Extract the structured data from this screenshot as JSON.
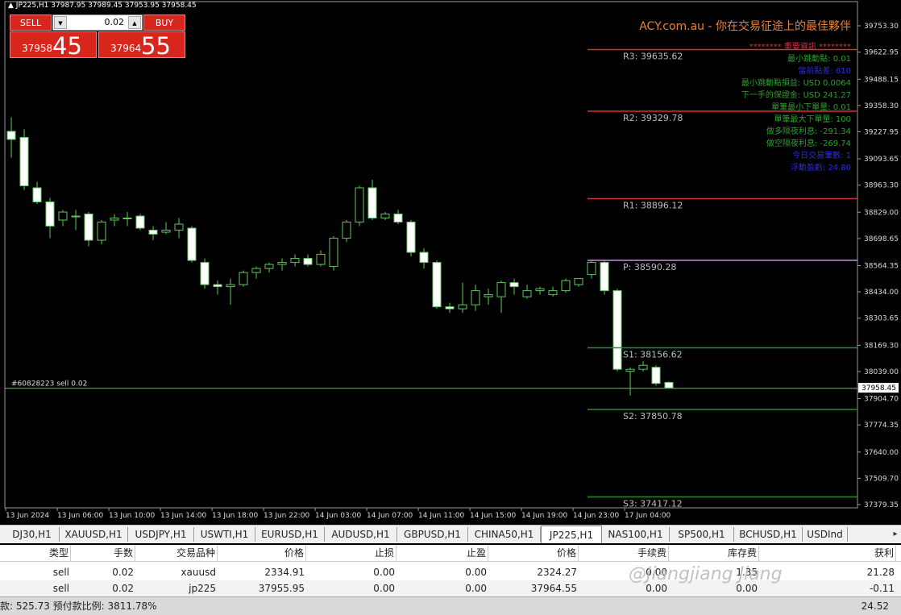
{
  "chart_header": {
    "symbol_line": "JP225,H1  37987.95 37989.45 37953.95 37958.45"
  },
  "trade_panel": {
    "sell_label": "SELL",
    "buy_label": "BUY",
    "lot": "0.02",
    "sell_price_small": "37958",
    "sell_price_big": "45",
    "buy_price_small": "37964",
    "buy_price_big": "55"
  },
  "brand_text": "ACY.com.au - 你在交易征途上的最佳夥伴",
  "info_panel": {
    "header": "******** 重要資訊 ********",
    "rows": [
      {
        "text": "最小跳動點: 0.01",
        "color": "#2e9e2e"
      },
      {
        "text": "當前點差: 610",
        "color": "#2a2ae0"
      },
      {
        "text": "最小跳動點損益: USD 0.0064",
        "color": "#2e9e2e"
      },
      {
        "text": "下一手的保證金: USD 241.27",
        "color": "#2e9e2e"
      },
      {
        "text": "單筆最小下單量: 0.01",
        "color": "#2e9e2e"
      },
      {
        "text": "單筆最大下單量: 100",
        "color": "#2e9e2e"
      },
      {
        "text": "做多隔夜利息: -291.34",
        "color": "#2e9e2e"
      },
      {
        "text": "做空隔夜利息: -269.74",
        "color": "#2e9e2e"
      },
      {
        "text": "今日交易筆數: 1",
        "color": "#2a2ae0"
      },
      {
        "text": "浮動盈虧: 24.80",
        "color": "#2a2ae0"
      }
    ]
  },
  "chart_data": {
    "type": "candlestick",
    "symbol": "JP225",
    "timeframe": "H1",
    "y_ticks": [
      39753.3,
      39622.95,
      39488.15,
      39358.3,
      39227.95,
      39093.65,
      38963.3,
      38829.0,
      38698.65,
      38564.35,
      38434.0,
      38303.65,
      38169.3,
      38039.0,
      37904.7,
      37774.35,
      37640.0,
      37509.7,
      37379.35
    ],
    "current_price": "37958.45",
    "order_line": {
      "label": "#60828223 sell 0.02",
      "price": 37955.95
    },
    "pivots": [
      {
        "name": "R3",
        "label": "R3: 39635.62",
        "value": 39635.62,
        "color": "#d63030"
      },
      {
        "name": "R2",
        "label": "R2: 39329.78",
        "value": 39329.78,
        "color": "#d63030"
      },
      {
        "name": "R1",
        "label": "R1: 38896.12",
        "value": 38896.12,
        "color": "#d63030"
      },
      {
        "name": "P",
        "label": "P: 38590.28",
        "value": 38590.28,
        "color": "#c58fe0"
      },
      {
        "name": "S1",
        "label": "S1: 38156.62",
        "value": 38156.62,
        "color": "#2e8b2e"
      },
      {
        "name": "S2",
        "label": "S2: 37850.78",
        "value": 37850.78,
        "color": "#2e8b2e"
      },
      {
        "name": "S3",
        "label": "S3: 37417.12",
        "value": 37417.12,
        "color": "#2e8b2e"
      }
    ],
    "x_labels": [
      "13 Jun 2024",
      "13 Jun 06:00",
      "13 Jun 10:00",
      "13 Jun 14:00",
      "13 Jun 18:00",
      "13 Jun 22:00",
      "14 Jun 03:00",
      "14 Jun 07:00",
      "14 Jun 11:00",
      "14 Jun 15:00",
      "14 Jun 19:00",
      "14 Jun 23:00",
      "17 Jun 04:00"
    ],
    "candles": [
      [
        39230,
        39300,
        39100,
        39190
      ],
      [
        39200,
        39240,
        38940,
        38960
      ],
      [
        38950,
        38980,
        38870,
        38880
      ],
      [
        38880,
        38900,
        38700,
        38760
      ],
      [
        38790,
        38840,
        38760,
        38830
      ],
      [
        38810,
        38840,
        38740,
        38810
      ],
      [
        38820,
        38830,
        38660,
        38690
      ],
      [
        38690,
        38790,
        38670,
        38780
      ],
      [
        38790,
        38820,
        38760,
        38800
      ],
      [
        38800,
        38830,
        38760,
        38800
      ],
      [
        38810,
        38820,
        38740,
        38750
      ],
      [
        38740,
        38760,
        38690,
        38720
      ],
      [
        38730,
        38780,
        38720,
        38740
      ],
      [
        38740,
        38800,
        38700,
        38770
      ],
      [
        38750,
        38760,
        38580,
        38590
      ],
      [
        38580,
        38600,
        38450,
        38470
      ],
      [
        38470,
        38490,
        38420,
        38460
      ],
      [
        38460,
        38500,
        38370,
        38470
      ],
      [
        38470,
        38540,
        38460,
        38530
      ],
      [
        38530,
        38560,
        38500,
        38550
      ],
      [
        38550,
        38580,
        38530,
        38570
      ],
      [
        38570,
        38600,
        38540,
        38580
      ],
      [
        38580,
        38620,
        38560,
        38600
      ],
      [
        38600,
        38620,
        38560,
        38570
      ],
      [
        38570,
        38640,
        38560,
        38620
      ],
      [
        38560,
        38710,
        38540,
        38700
      ],
      [
        38700,
        38790,
        38680,
        38780
      ],
      [
        38780,
        38960,
        38760,
        38950
      ],
      [
        38950,
        38990,
        38790,
        38800
      ],
      [
        38800,
        38830,
        38790,
        38820
      ],
      [
        38820,
        38840,
        38770,
        38780
      ],
      [
        38780,
        38790,
        38610,
        38630
      ],
      [
        38630,
        38650,
        38550,
        38580
      ],
      [
        38580,
        38590,
        38350,
        38360
      ],
      [
        38360,
        38380,
        38330,
        38350
      ],
      [
        38350,
        38480,
        38330,
        38370
      ],
      [
        38370,
        38470,
        38340,
        38440
      ],
      [
        38410,
        38450,
        38370,
        38420
      ],
      [
        38410,
        38490,
        38330,
        38480
      ],
      [
        38480,
        38500,
        38420,
        38460
      ],
      [
        38410,
        38470,
        38400,
        38440
      ],
      [
        38440,
        38460,
        38420,
        38450
      ],
      [
        38420,
        38460,
        38410,
        38440
      ],
      [
        38440,
        38500,
        38430,
        38490
      ],
      [
        38470,
        38500,
        38460,
        38500
      ],
      [
        38520,
        38590,
        38500,
        38580
      ],
      [
        38580,
        38590,
        38420,
        38440
      ],
      [
        38440,
        38450,
        38040,
        38050
      ],
      [
        38040,
        38060,
        37920,
        38050
      ],
      [
        38050,
        38090,
        38040,
        38070
      ],
      [
        38060,
        38070,
        37970,
        37980
      ],
      [
        37985,
        37990,
        37955,
        37958
      ]
    ]
  },
  "tabs": [
    "DJ30,H1",
    "XAUUSD,H1",
    "USDJPY,H1",
    "USWTI,H1",
    "EURUSD,H1",
    "AUDUSD,H1",
    "GBPUSD,H1",
    "CHINA50,H1",
    "JP225,H1",
    "NAS100,H1",
    "SP500,H1",
    "BCHUSD,H1",
    "USDInd"
  ],
  "active_tab": "JP225,H1",
  "orders": {
    "headers": [
      "类型",
      "手数",
      "交易品种",
      "价格",
      "止损",
      "止盈",
      "价格",
      "手续费",
      "库存费",
      "获利"
    ],
    "rows": [
      [
        "sell",
        "0.02",
        "xauusd",
        "2334.91",
        "0.00",
        "0.00",
        "2324.27",
        "0.00",
        "1.35",
        "21.28"
      ],
      [
        "sell",
        "0.02",
        "jp225",
        "37955.95",
        "0.00",
        "0.00",
        "37964.55",
        "0.00",
        "0.00",
        "-0.11"
      ]
    ],
    "summary_left": "款: 525.73  预付款比例: 3811.78%",
    "summary_right": "24.52"
  },
  "watermark": "@Jiangjiang Jiang"
}
